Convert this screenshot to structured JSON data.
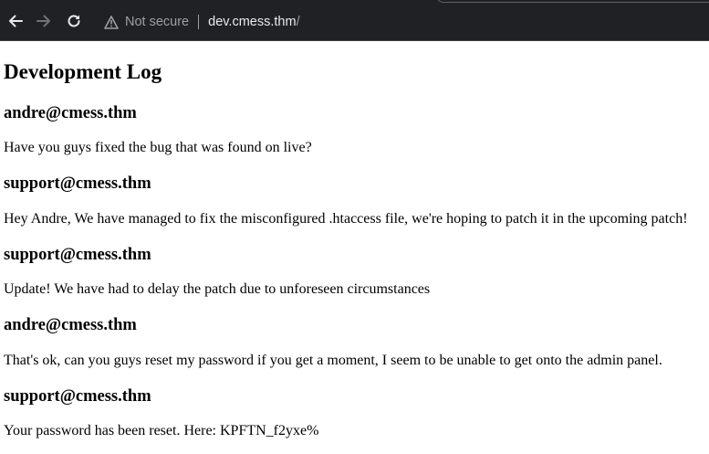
{
  "browser": {
    "security_label": "Not secure",
    "url_host": "dev.cmess.thm",
    "url_path": "/",
    "icons": {
      "back": "back-arrow-icon",
      "forward": "forward-arrow-icon",
      "reload": "reload-icon",
      "security": "warning-triangle-icon"
    }
  },
  "page": {
    "title": "Development Log",
    "entries": [
      {
        "author": "andre@cmess.thm",
        "message": "Have you guys fixed the bug that was found on live?"
      },
      {
        "author": "support@cmess.thm",
        "message": "Hey Andre, We have managed to fix the misconfigured .htaccess file, we're hoping to patch it in the upcoming patch!"
      },
      {
        "author": "support@cmess.thm",
        "message": "Update! We have had to delay the patch due to unforeseen circumstances"
      },
      {
        "author": "andre@cmess.thm",
        "message": "That's ok, can you guys reset my password if you get a moment, I seem to be unable to get onto the admin panel."
      },
      {
        "author": "support@cmess.thm",
        "message": "Your password has been reset. Here: KPFTN_f2yxe%"
      }
    ]
  }
}
